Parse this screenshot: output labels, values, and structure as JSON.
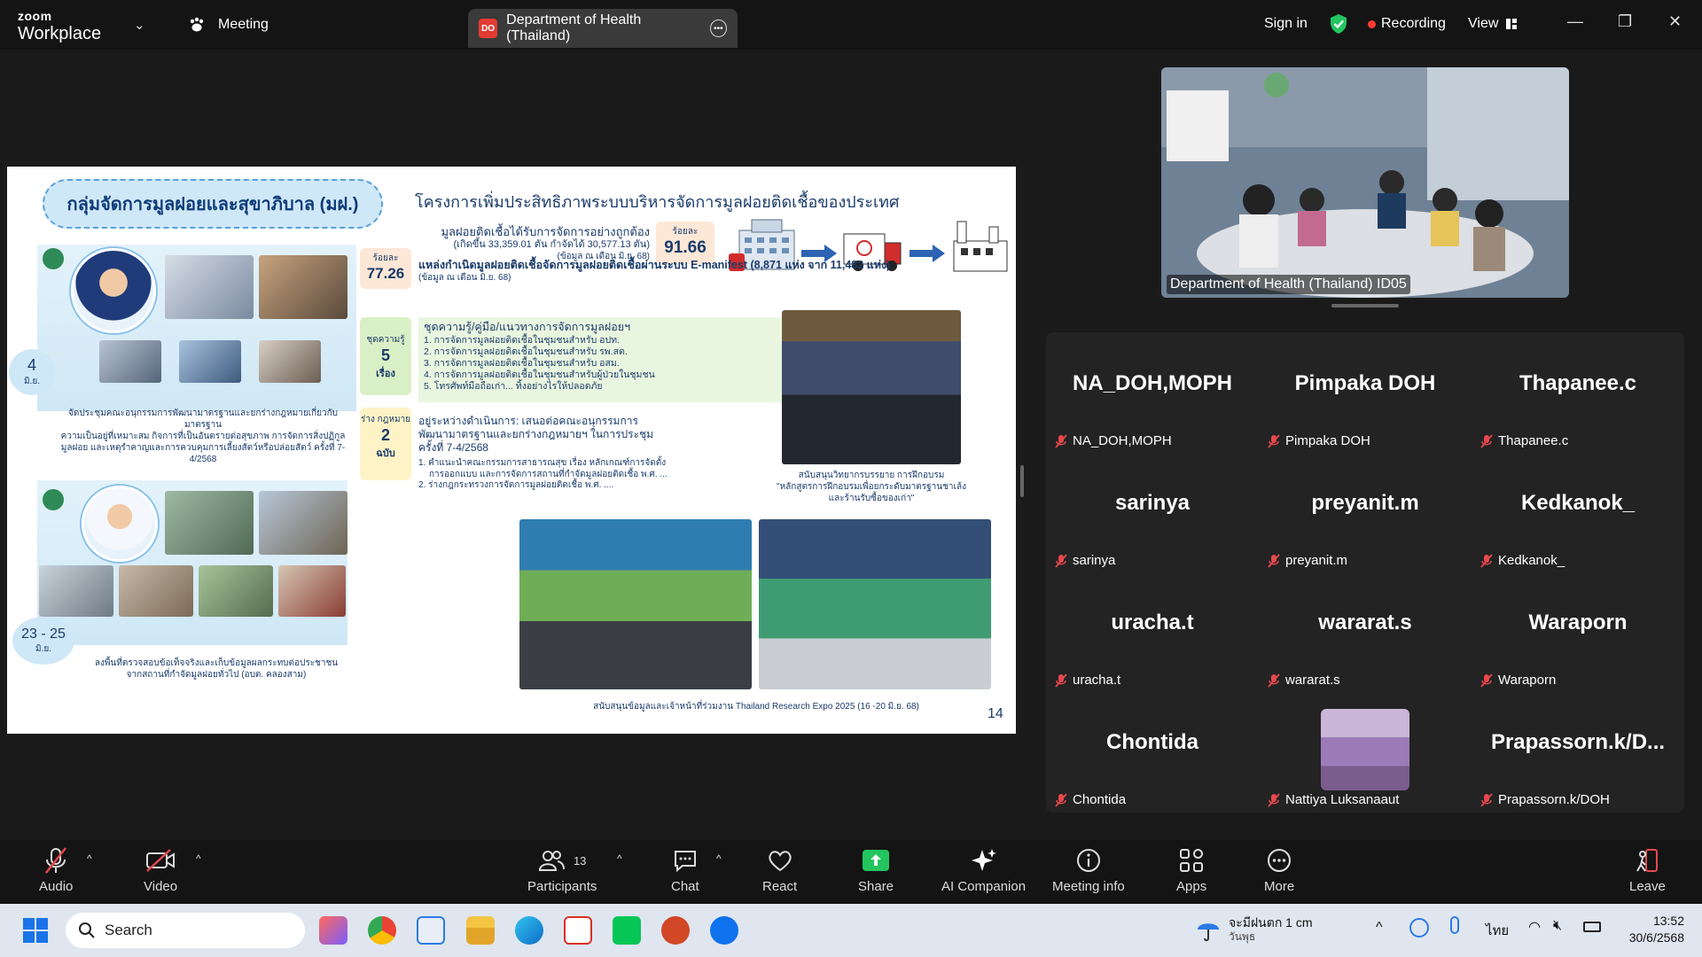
{
  "titlebar": {
    "logo_top": "zoom",
    "logo_bottom": "Workplace",
    "meeting_tab": "Meeting",
    "active_tab_badge": "DO",
    "active_tab_title": "Department of Health (Thailand)",
    "sign_in": "Sign in",
    "recording": "Recording",
    "view": "View"
  },
  "slide": {
    "header_pill": "กลุ่มจัดการมูลฝอยและสุขาภิบาล (มฝ.)",
    "title": "โครงการเพิ่มประสิทธิภาพระบบบริหารจัดการมูลฝอยติดเชื้อของประเทศ",
    "stat1_line1": "มูลฝอยติดเชื้อได้รับการจัดการอย่างถูกต้อง",
    "stat1_line2": "(เกิดขึ้น 33,359.01 ตัน กำจัดได้ 30,577.13 ตัน)",
    "stat1_line3": "(ข้อมูล ณ เดือน มิ.ย. 68)",
    "stat1_label": "ร้อยละ",
    "stat1_value": "91.66",
    "stat2_label": "ร้อยละ",
    "stat2_value": "77.26",
    "stat2_line1": "แหล่งกำเนิดมูลฝอยติดเชื้อจัดการมูลฝอยติดเชื้อผ่านระบบ E-manifest (8,871 แห่ง จาก 11,482 แห่ง)",
    "stat2_line2": "(ข้อมูล ณ เดือน มิ.ย. 68)",
    "kit_label": "ชุดความรู้",
    "kit_value": "5",
    "kit_unit": "เรื่อง",
    "kit_title": "ชุดความรู้/คู่มือ/แนวทางการจัดการมูลฝอยฯ",
    "kit_items": [
      "1.  การจัดการมูลฝอยติดเชื้อในชุมชนสำหรับ อปท.",
      "2.  การจัดการมูลฝอยติดเชื้อในชุมชนสำหรับ รพ.สต.",
      "3.  การจัดการมูลฝอยติดเชื้อในชุมชนสำหรับ อสม.",
      "4.  การจัดการมูลฝอยติดเชื้อในชุมชนสำหรับผู้ป่วยในชุมชน",
      "5.  โทรศัพท์มือถือเก่า... ทิ้งอย่างไรให้ปลอดภัย"
    ],
    "law_label": "ร่าง กฎหมาย",
    "law_value": "2",
    "law_unit": "ฉบับ",
    "law_line1": "อยู่ระหว่างดำเนินการ: เสนอต่อคณะอนุกรรมการ",
    "law_line2": "พัฒนามาตรฐานและยกร่างกฎหมายฯ ในการประชุม",
    "law_line3": "ครั้งที่ 7-4/2568",
    "law_item1": "1.  คำแนะนำคณะกรรมการสาธารณสุข เรื่อง หลักเกณฑ์การจัดตั้ง",
    "law_item1b": "การออกแบบ และการจัดการสถานที่กำจัดมูลฝอยติดเชื้อ พ.ศ. ...",
    "law_item2": "2.  ร่างกฎกระทรวงการจัดการมูลฝอยติดเชื้อ พ.ศ. ....",
    "date1_num": "4",
    "date1_month": "มิ.ย.",
    "caption1_line1": "จัดประชุมคณะอนุกรรมการพัฒนามาตรฐานและยกร่างกฎหมายเกี่ยวกับมาตรฐาน",
    "caption1_line2": "ความเป็นอยู่ที่เหมาะสม กิจการที่เป็นอันตรายต่อสุขภาพ การจัดการสิ่งปฏิกูล",
    "caption1_line3": "มูลฝอย และเหตุรำคาญและการควบคุมการเลี้ยงสัตว์หรือปล่อยสัตว์ ครั้งที่ 7-4/2568",
    "date2_num": "23 - 25",
    "date2_month": "มิ.ย.",
    "caption2_line1": "ลงพื้นที่ตรวจสอบข้อเท็จจริงและเก็บข้อมูลผลกระทบต่อประชาชน",
    "caption2_line2": "จากสถานที่กำจัดมูลฝอยทั่วไป (อบต. คลองสาม)",
    "caption3_line1": "สนับสนุนวิทยากรบรรยาย การฝึกอบรม",
    "caption3_line2": "\"หลักสูตรการฝึกอบรมเพื่อยกระดับมาตรฐานชาเล้ง",
    "caption3_line3": "และร้านรับซื้อของเก่า\"",
    "caption4": "สนับสนุนข้อมูลและเจ้าหน้าที่ร่วมงาน Thailand Research Expo 2025 (16 -20 มิ.ย. 68)",
    "page_number": "14"
  },
  "self_view": {
    "label": "Department of Health (Thailand) ID05"
  },
  "participants": [
    {
      "big": "NA_DOH,MOPH",
      "small": "NA_DOH,MOPH"
    },
    {
      "big": "Pimpaka DOH",
      "small": "Pimpaka DOH"
    },
    {
      "big": "Thapanee.c",
      "small": "Thapanee.c"
    },
    {
      "big": "sarinya",
      "small": "sarinya"
    },
    {
      "big": "preyanit.m",
      "small": "preyanit.m"
    },
    {
      "big": "Kedkanok_",
      "small": "Kedkanok_"
    },
    {
      "big": "uracha.t",
      "small": "uracha.t"
    },
    {
      "big": "wararat.s",
      "small": "wararat.s"
    },
    {
      "big": "Waraporn",
      "small": "Waraporn"
    },
    {
      "big": "Chontida",
      "small": "Chontida"
    },
    {
      "big": "",
      "small": "Nattiya Luksanaaut"
    },
    {
      "big": "Prapassorn.k/D...",
      "small": "Prapassorn.k/DOH"
    }
  ],
  "toolbar": {
    "audio": "Audio",
    "video": "Video",
    "participants": "Participants",
    "participants_count": "13",
    "chat": "Chat",
    "react": "React",
    "share": "Share",
    "ai_companion": "AI Companion",
    "meeting_info": "Meeting info",
    "apps": "Apps",
    "more": "More",
    "leave": "Leave"
  },
  "taskbar": {
    "search": "Search",
    "weather_line1": "จะมีฝนตก 1 cm",
    "weather_line2": "วันพุธ",
    "language": "ไทย",
    "time": "13:52",
    "date": "30/6/2568"
  },
  "colors": {
    "share_green": "#22c55e",
    "recording_red": "#ff3b30",
    "mic_off_red": "#e5484d",
    "accent_blue": "#0e72ed"
  }
}
